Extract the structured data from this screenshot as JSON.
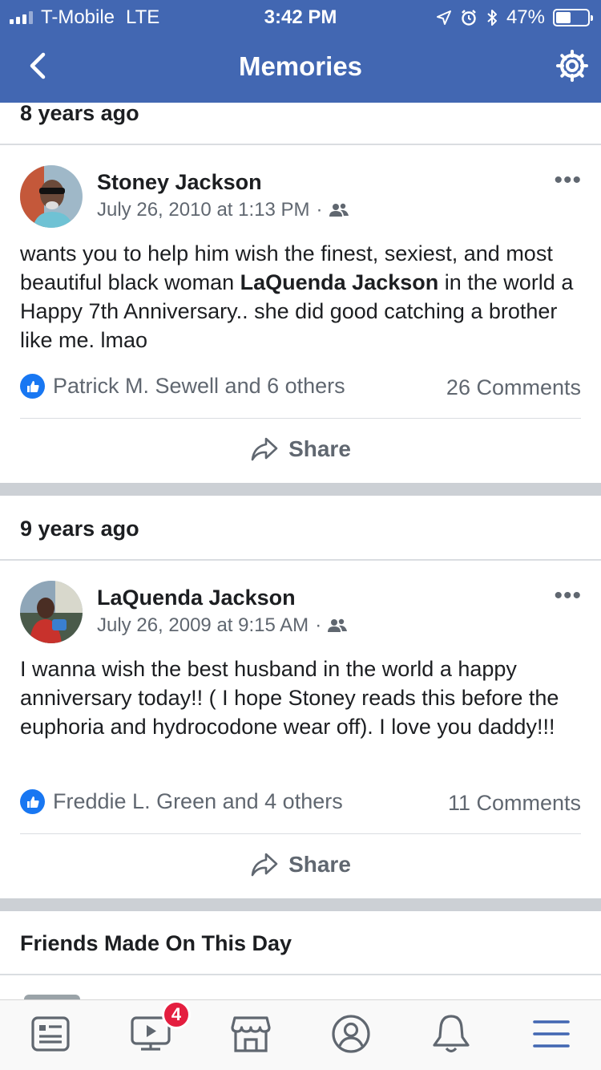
{
  "status_bar": {
    "carrier": "T-Mobile",
    "network": "LTE",
    "time": "3:42 PM",
    "battery": "47%",
    "battery_level": 0.47
  },
  "header": {
    "title": "Memories",
    "back_icon": "chevron-left-icon",
    "settings_icon": "gear-icon"
  },
  "sections": [
    {
      "title": "8 years ago",
      "post": {
        "author": "Stoney Jackson",
        "date": "July 26, 2010 at 1:13 PM",
        "audience_separator": "·",
        "audience_icon": "friends-icon",
        "text_before": "wants you to help him wish the finest, sexiest, and most beautiful black woman ",
        "text_tag": "LaQuenda Jackson",
        "text_after": " in the world a Happy 7th Anniversary.. she did good catching a brother like me. lmao",
        "likes": "Patrick M. Sewell and 6 others",
        "comments": "26 Comments",
        "share_label": "Share"
      }
    },
    {
      "title": "9 years ago",
      "post": {
        "author": "LaQuenda Jackson",
        "date": "July 26, 2009 at 9:15 AM",
        "audience_separator": "·",
        "audience_icon": "friends-icon",
        "text_before": "I wanna wish the best husband in the world a happy anniversary today!!  ( I hope Stoney reads this before the euphoria and hydrocodone wear off).  I love you daddy!!!",
        "likes": "Freddie L. Green and 4 others",
        "comments": "11 Comments",
        "share_label": "Share"
      }
    }
  ],
  "friends_section": {
    "title": "Friends Made On This Day"
  },
  "tabbar": {
    "items": [
      "news-feed-icon",
      "watch-icon",
      "marketplace-icon",
      "profile-icon",
      "notifications-icon",
      "menu-icon"
    ],
    "watch_badge": "4",
    "active_color": "#4267b2"
  },
  "colors": {
    "brand_blue": "#4267b2",
    "like_blue": "#1877f2",
    "badge_red": "#e41e3f",
    "separator_gray": "#ccd0d5"
  }
}
